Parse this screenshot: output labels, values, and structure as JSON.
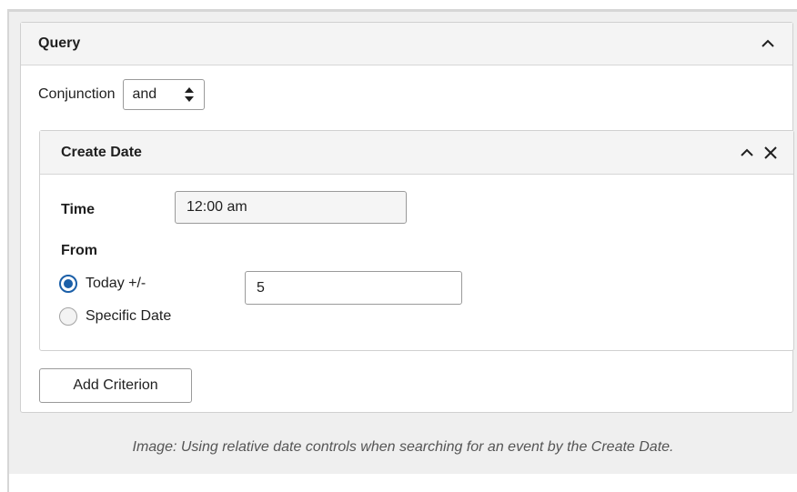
{
  "query": {
    "title": "Query",
    "conjunction_label": "Conjunction",
    "conjunction_value": "and"
  },
  "criterion": {
    "title": "Create Date",
    "time_label": "Time",
    "time_value": "12:00 am",
    "from_label": "From",
    "options": [
      {
        "label": "Today +/-",
        "selected": true
      },
      {
        "label": "Specific Date",
        "selected": false
      }
    ],
    "offset_value": "5"
  },
  "add_criterion_label": "Add Criterion",
  "caption": "Image: Using relative date controls when searching for an event by the Create Date.",
  "icons": [
    "chevron-up-icon",
    "close-icon",
    "select-arrows-icon"
  ],
  "colors": {
    "accent": "#1b5fa8",
    "header_bg": "#f4f4f4",
    "figure_bg": "#efefef"
  }
}
